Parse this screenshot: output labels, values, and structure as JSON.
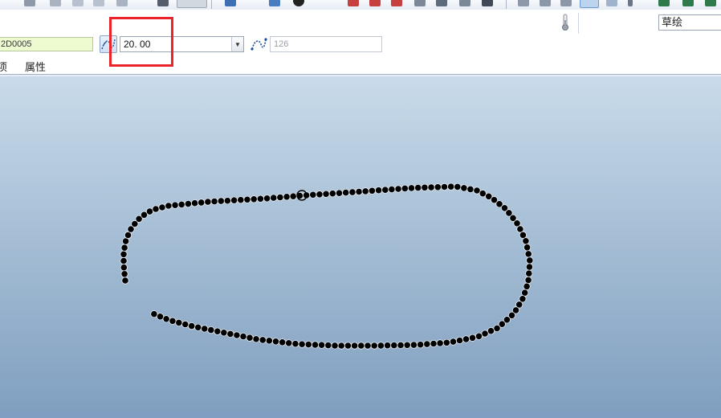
{
  "toolbar": {
    "icons": [
      "undo-icon",
      "redo-icon",
      "copy-icon",
      "paste-icon",
      "regenerate-icon",
      "view-icon",
      "zoom-icon",
      "orient-icon",
      "settings-icon"
    ]
  },
  "header": {
    "mode_select_value": "草绘",
    "status_icon": "thermometer-icon"
  },
  "feature": {
    "name_value": "2D0005",
    "tolerance_value": "20. 00",
    "point_count_placeholder": "126"
  },
  "tabs": [
    {
      "label": "项"
    },
    {
      "label": "属性"
    }
  ],
  "colors": {
    "highlight": "#e8232a",
    "canvas_top": "#c9dbea",
    "canvas_bottom": "#7f9ebf",
    "name_field_bg": "#eefbd0",
    "curve_points": "#000000"
  }
}
